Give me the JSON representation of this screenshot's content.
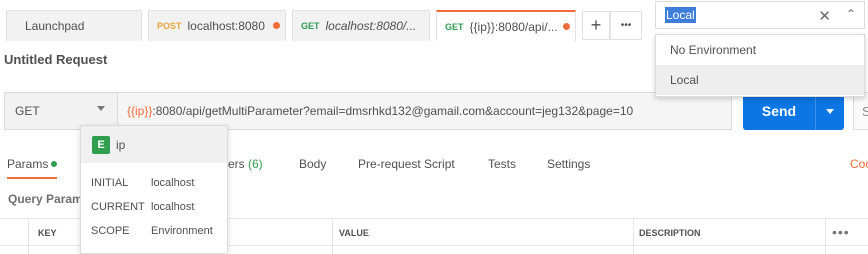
{
  "tabs": [
    {
      "method": "",
      "method_color": "",
      "title": "Launchpad",
      "italic": false,
      "dirty": false
    },
    {
      "method": "POST",
      "method_color": "#e8a33c",
      "title": "localhost:8080",
      "italic": false,
      "dirty": true
    },
    {
      "method": "GET",
      "method_color": "#2f9e4f",
      "title": "localhost:8080/...",
      "italic": true,
      "dirty": false
    },
    {
      "method": "GET",
      "method_color": "#2f9e4f",
      "title": "{{ip}}:8080/api/...",
      "italic": false,
      "dirty": true
    }
  ],
  "tab_actions": {
    "add_icon": "+",
    "more_icon": "•••"
  },
  "environment": {
    "selected": "Local",
    "clear_icon": "✕",
    "chevron_icon": "⌃",
    "options": [
      "No Environment",
      "Local"
    ],
    "highlighted_option": "Local"
  },
  "request": {
    "name": "Untitled Request",
    "method": "GET",
    "url_var": "{{ip}}",
    "url_rest": ":8080/api/getMultiParameter?email=dmsrhkd132@gamail.com&account=jeg132&page=10",
    "send_label": "Send",
    "save_label": "S"
  },
  "subtabs": {
    "params": "Params",
    "headers_prefix": "ers",
    "headers_count": "(6)",
    "body": "Body",
    "prescript": "Pre-request Script",
    "tests": "Tests",
    "settings": "Settings",
    "code": "Coo"
  },
  "query_params_label": "Query Param",
  "table": {
    "columns": [
      "KEY",
      "VALUE",
      "DESCRIPTION"
    ],
    "more_icon": "•••"
  },
  "variable_tooltip": {
    "badge": "E",
    "name": "ip",
    "rows": [
      {
        "key": "INITIAL",
        "value": "localhost"
      },
      {
        "key": "CURRENT",
        "value": "localhost"
      },
      {
        "key": "SCOPE",
        "value": "Environment"
      }
    ]
  },
  "colors": {
    "accent": "#f26b3a",
    "send": "#0b76e4",
    "env_green": "#2f9e4f"
  }
}
